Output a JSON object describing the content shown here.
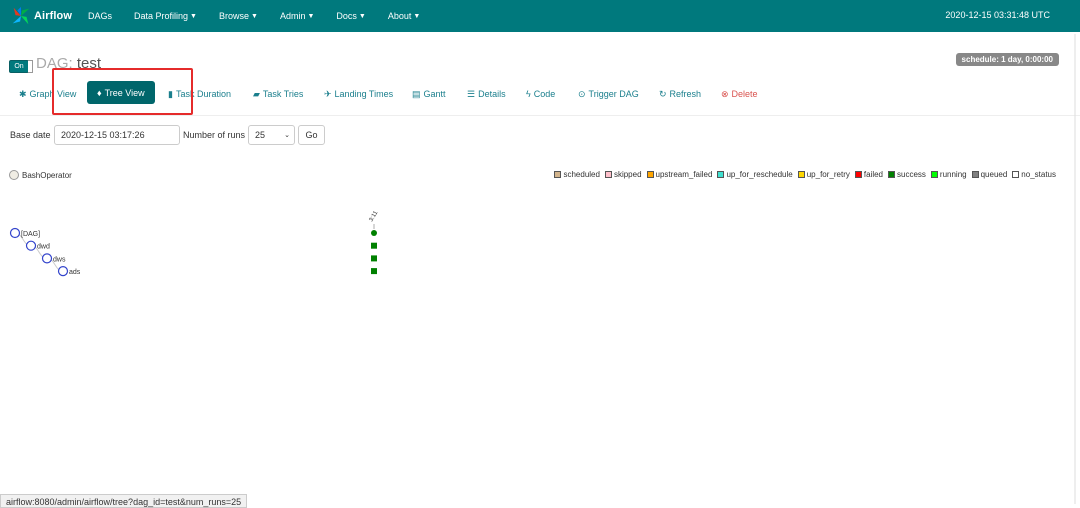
{
  "navbar": {
    "brand": "Airflow",
    "items": [
      {
        "label": "DAGs",
        "dropdown": false
      },
      {
        "label": "Data Profiling",
        "dropdown": true
      },
      {
        "label": "Browse",
        "dropdown": true
      },
      {
        "label": "Admin",
        "dropdown": true
      },
      {
        "label": "Docs",
        "dropdown": true
      },
      {
        "label": "About",
        "dropdown": true
      }
    ],
    "time": "2020-12-15 03:31:48 UTC"
  },
  "dag": {
    "toggle": "On",
    "title_prefix": "DAG: ",
    "title_name": "test",
    "schedule": "schedule: 1 day, 0:00:00"
  },
  "tabs": [
    {
      "label": "Graph View",
      "icon": "asterisk-icon",
      "glyph": "✱"
    },
    {
      "label": "Tree View",
      "icon": "tree-icon",
      "glyph": "♦"
    },
    {
      "label": "Task Duration",
      "icon": "bar-chart-icon",
      "glyph": "▮"
    },
    {
      "label": "Task Tries",
      "icon": "duplicate-icon",
      "glyph": "▰"
    },
    {
      "label": "Landing Times",
      "icon": "plane-icon",
      "glyph": "✈"
    },
    {
      "label": "Gantt",
      "icon": "gantt-icon",
      "glyph": "▤"
    },
    {
      "label": "Details",
      "icon": "list-icon",
      "glyph": "☰"
    },
    {
      "label": "Code",
      "icon": "flash-icon",
      "glyph": "ϟ"
    },
    {
      "label": "Trigger DAG",
      "icon": "play-circle-icon",
      "glyph": "⊙"
    },
    {
      "label": "Refresh",
      "icon": "refresh-icon",
      "glyph": "↻"
    },
    {
      "label": "Delete",
      "icon": "remove-circle-icon",
      "glyph": "⊗"
    }
  ],
  "form": {
    "base_date_label": "Base date",
    "base_date_value": "2020-12-15 03:17:26",
    "num_runs_label": "Number of runs",
    "num_runs_value": "25",
    "go_label": "Go"
  },
  "operator_legend": {
    "label": "BashOperator"
  },
  "state_legend": [
    {
      "label": "scheduled",
      "color": "#d2b48c"
    },
    {
      "label": "skipped",
      "color": "#ffc0cb"
    },
    {
      "label": "upstream_failed",
      "color": "#ffa500"
    },
    {
      "label": "up_for_reschedule",
      "color": "#40e0d0"
    },
    {
      "label": "up_for_retry",
      "color": "#ffd700"
    },
    {
      "label": "failed",
      "color": "#ff0000"
    },
    {
      "label": "success",
      "color": "#008000"
    },
    {
      "label": "running",
      "color": "#00ff00"
    },
    {
      "label": "queued",
      "color": "#808080"
    },
    {
      "label": "no_status",
      "color": "#ffffff"
    }
  ],
  "tree": {
    "run_label": "3:11",
    "nodes": [
      "[DAG]",
      "dwd",
      "dws",
      "ads"
    ],
    "node_states": [
      "success",
      "success",
      "success",
      "success"
    ]
  },
  "status_bar": "airflow:8080/admin/airflow/tree?dag_id=test&num_runs=25"
}
